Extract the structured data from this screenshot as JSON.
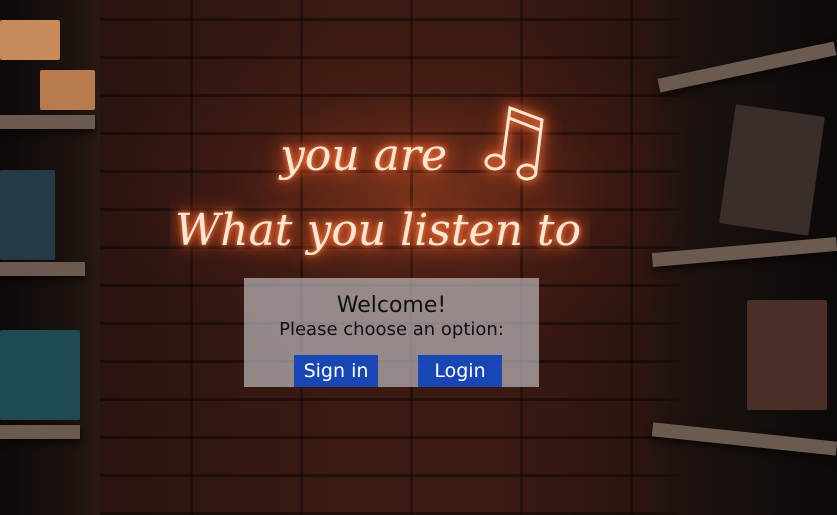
{
  "background": {
    "neon_line1": "you are",
    "neon_line2": "What you listen to",
    "neon_symbol": "music-note"
  },
  "dialog": {
    "title": "Welcome!",
    "subtitle": "Please choose an option:",
    "buttons": {
      "signin_label": "Sign in",
      "login_label": "Login"
    },
    "button_color": "#1847b5"
  }
}
